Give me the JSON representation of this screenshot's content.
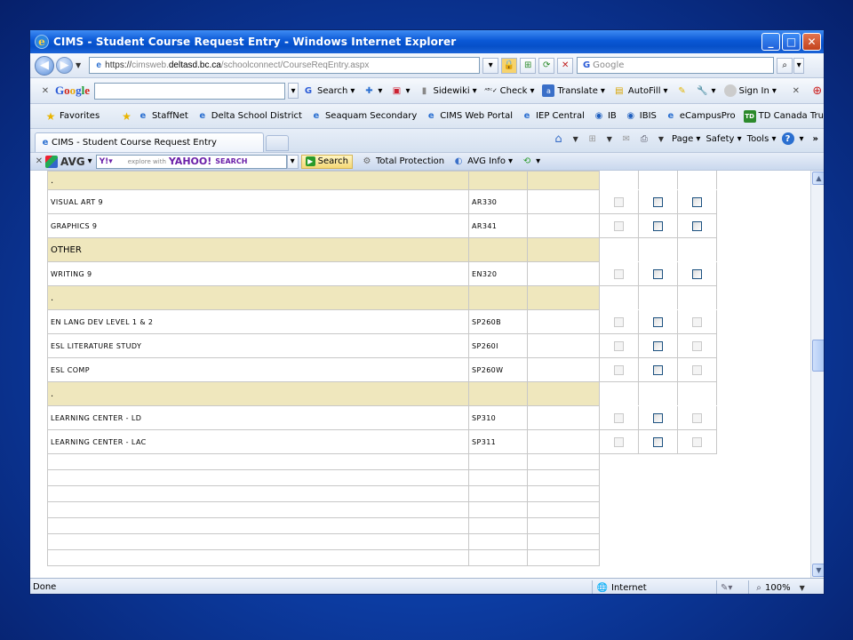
{
  "window": {
    "title": "CIMS - Student Course Request Entry - Windows Internet Explorer"
  },
  "address": {
    "proto": "https://",
    "pre": "cimsweb.",
    "domain": "deltasd.bc.ca",
    "path": "/schoolconnect/CourseReqEntry.aspx",
    "search_placeholder": "Google"
  },
  "google_toolbar": {
    "logo": [
      "G",
      "o",
      "o",
      "g",
      "l",
      "e"
    ],
    "items": [
      "Search",
      "Sidewiki",
      "Check",
      "Translate",
      "AutoFill",
      "Sign In"
    ]
  },
  "favorites": {
    "label": "Favorites",
    "links": [
      "StaffNet",
      "Delta School District",
      "Seaquam Secondary",
      "CIMS Web Portal",
      "IEP Central",
      "IB",
      "IBIS",
      "eCampusPro",
      "TD Canada Trust"
    ]
  },
  "tab": {
    "label": "CIMS - Student Course Request Entry"
  },
  "commands": [
    "Page",
    "Safety",
    "Tools"
  ],
  "avg_toolbar": {
    "brand": "AVG",
    "yahoo_prefix": "explore with",
    "yahoo_brand": "YAHOO!",
    "yahoo_search": "SEARCH",
    "search_button": "Search",
    "protection": "Total Protection",
    "info": "AVG Info"
  },
  "rows": [
    {
      "kind": "section",
      "name": "."
    },
    {
      "kind": "course",
      "name": "VISUAL ART 9",
      "code": "AR330",
      "checks": [
        "dis",
        "on",
        "on"
      ]
    },
    {
      "kind": "course",
      "name": "GRAPHICS 9",
      "code": "AR341",
      "checks": [
        "dis",
        "on",
        "on"
      ]
    },
    {
      "kind": "section",
      "name": "OTHER"
    },
    {
      "kind": "course",
      "name": "WRITING 9",
      "code": "EN320",
      "checks": [
        "dis",
        "on",
        "on"
      ]
    },
    {
      "kind": "section",
      "name": "."
    },
    {
      "kind": "course",
      "name": "EN LANG DEV LEVEL 1 & 2",
      "code": "SP260B",
      "checks": [
        "dis",
        "on",
        "dis"
      ]
    },
    {
      "kind": "course",
      "name": "ESL LITERATURE STUDY",
      "code": "SP260I",
      "checks": [
        "dis",
        "on",
        "dis"
      ]
    },
    {
      "kind": "course",
      "name": "ESL COMP",
      "code": "SP260W",
      "checks": [
        "dis",
        "on",
        "dis"
      ]
    },
    {
      "kind": "section",
      "name": "."
    },
    {
      "kind": "course",
      "name": "LEARNING CENTER - LD",
      "code": "SP310",
      "checks": [
        "dis",
        "on",
        "dis"
      ]
    },
    {
      "kind": "course",
      "name": "LEARNING CENTER - LAC",
      "code": "SP311",
      "checks": [
        "dis",
        "on",
        "dis"
      ]
    }
  ],
  "blank_rows": 7,
  "status": {
    "text": "Done",
    "zone": "Internet",
    "zoom": "100%"
  }
}
